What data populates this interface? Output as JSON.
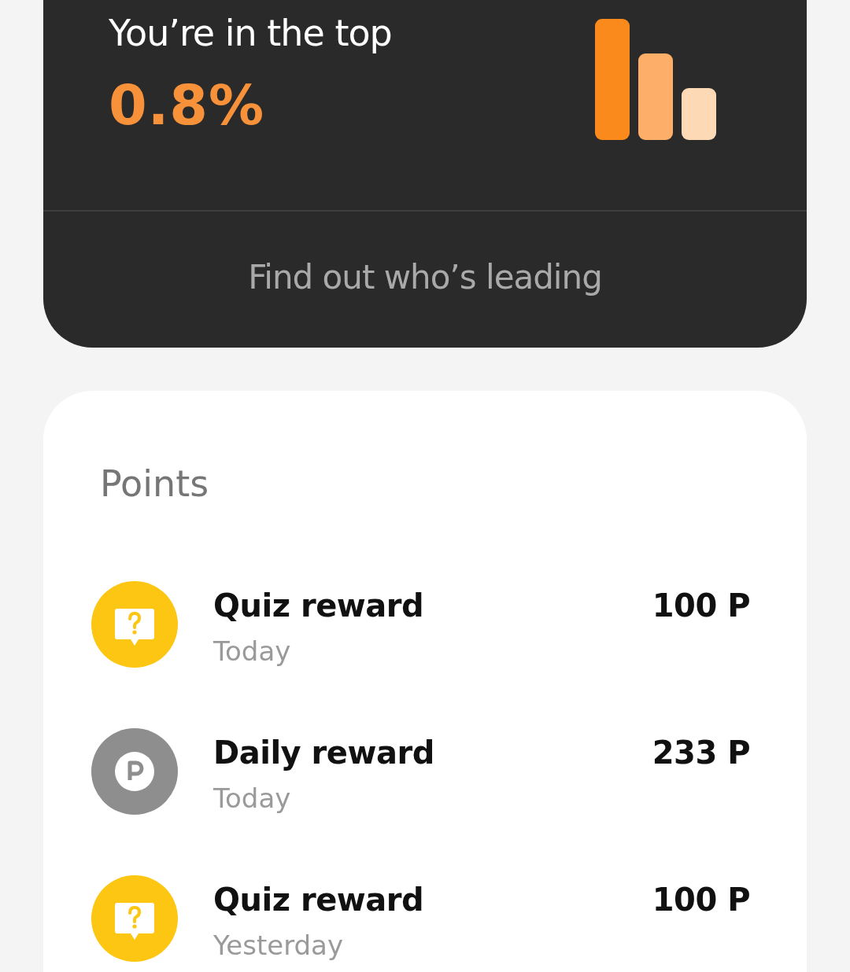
{
  "rank_card": {
    "title": "You’re in the top",
    "percent": "0.8%",
    "link": "Find out who’s leading"
  },
  "points": {
    "heading": "Points",
    "entries": [
      {
        "kind": "quiz",
        "title": "Quiz reward",
        "date": "Today",
        "amount": "100 P"
      },
      {
        "kind": "daily",
        "title": "Daily reward",
        "date": "Today",
        "amount": "233 P"
      },
      {
        "kind": "quiz",
        "title": "Quiz reward",
        "date": "Yesterday",
        "amount": "100 P"
      }
    ]
  }
}
